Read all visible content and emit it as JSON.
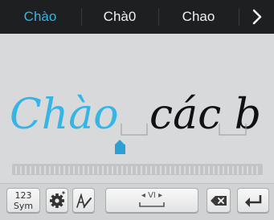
{
  "suggestions": {
    "items": [
      "Chào",
      "Chà0",
      "Chao"
    ],
    "more_icon": "chevron-right-icon"
  },
  "handwriting": {
    "recognized_word": "Chào",
    "text_after": "các b",
    "accent_color": "#35b5e6",
    "ink_color": "#111111"
  },
  "toolbar": {
    "sym_line1": "123",
    "sym_line2": "Sym",
    "settings_icon": "gear-icon",
    "handwrite_icon": "handwriting-icon",
    "language_label": "VI",
    "delete_icon": "backspace-icon",
    "enter_icon": "enter-icon"
  }
}
